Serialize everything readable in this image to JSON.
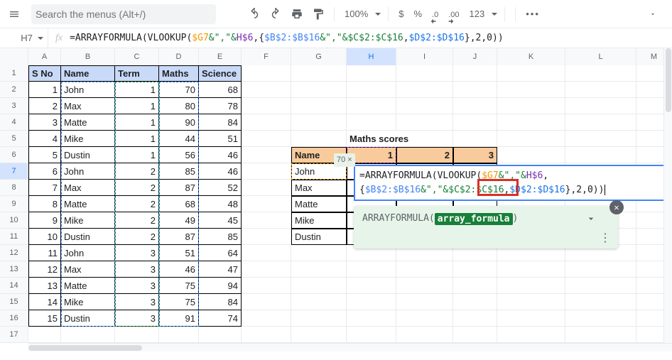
{
  "toolbar": {
    "search_placeholder": "Search the menus (Alt+/)",
    "zoom": "100%",
    "money": "$",
    "pct": "%",
    "dec0": ".0",
    "dec00": ".00",
    "fmt": "123",
    "more": "•••"
  },
  "formulabar": {
    "cellref": "H7",
    "fx": "fx",
    "formula_prefix": "=ARRAYFORMULA(VLOOKUP(",
    "f_g7": "$G7",
    "f_amp1": "&\",\"&",
    "f_h6": "H$6",
    "f_comma1": ",{",
    "f_b2": "$B$2:$B$16",
    "f_amp2": "&\",\"&",
    "f_c2": "$C$2:$C$16",
    "f_comma2": ",",
    "f_d2": "$D$2:$D$16",
    "f_tail": "},2,0))"
  },
  "cols": [
    "A",
    "B",
    "C",
    "D",
    "E",
    "F",
    "G",
    "H",
    "I",
    "J",
    "K",
    "L",
    "M"
  ],
  "table": {
    "headers": [
      "S No",
      "Name",
      "Term",
      "Maths",
      "Science"
    ],
    "rows": [
      [
        1,
        "John",
        1,
        70,
        68
      ],
      [
        2,
        "Max",
        1,
        80,
        78
      ],
      [
        3,
        "Matte",
        1,
        90,
        84
      ],
      [
        4,
        "Mike",
        1,
        44,
        51
      ],
      [
        5,
        "Dustin",
        1,
        56,
        46
      ],
      [
        6,
        "John",
        2,
        85,
        46
      ],
      [
        7,
        "Max",
        2,
        87,
        52
      ],
      [
        8,
        "Matte",
        2,
        68,
        48
      ],
      [
        9,
        "Mike",
        2,
        49,
        45
      ],
      [
        10,
        "Dustin",
        2,
        87,
        85
      ],
      [
        11,
        "John",
        3,
        51,
        64
      ],
      [
        12,
        "Max",
        3,
        46,
        47
      ],
      [
        13,
        "Matte",
        3,
        75,
        94
      ],
      [
        14,
        "Mike",
        3,
        75,
        84
      ],
      [
        15,
        "Dustin",
        3,
        91,
        74
      ]
    ]
  },
  "side": {
    "title": "Maths scores",
    "name_hdr": "Name",
    "cols": [
      "1",
      "2",
      "3"
    ],
    "names": [
      "John",
      "Max",
      "Matte",
      "Mike",
      "Dustin"
    ]
  },
  "floatbox": {
    "preview": "70 ×",
    "l1a": "=ARRAYFORMULA(VLOOKUP(",
    "l1_g7": "$G7",
    "l1b": "&\",\"&",
    "l1_h6": "H$6",
    "l1c": ",{",
    "l1_b": "$B$2:$B$16",
    "l1d": "&\",\"&",
    "l1_c": "$C$2:$C$16",
    "l1e": ",",
    "l2_d": "$D$2:$D$16",
    "l2b": "},2,0))"
  },
  "tooltip": {
    "fn": "ARRAYFORMULA(",
    "arg": "array_formula",
    "close": ")"
  }
}
